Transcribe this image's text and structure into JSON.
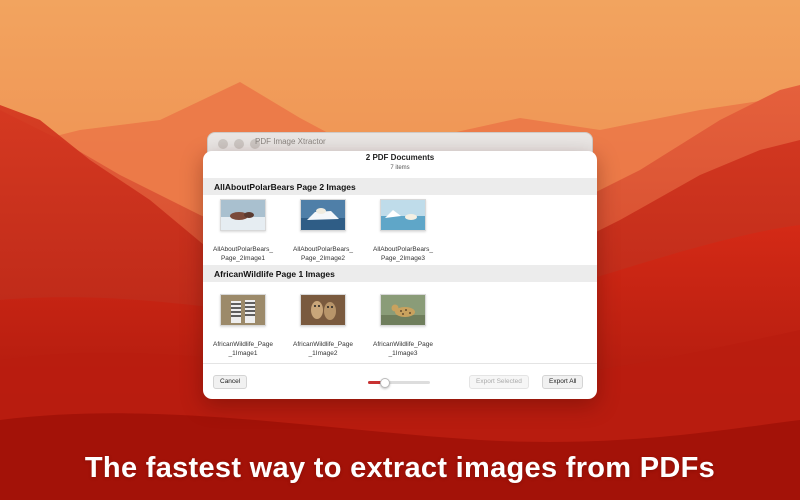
{
  "window": {
    "title": "PDF Image Xtractor"
  },
  "sheet": {
    "title": "2 PDF Documents",
    "subtitle": "7 items"
  },
  "sections": [
    {
      "header": "AllAboutPolarBears Page 2 Images",
      "items": [
        {
          "line1": "AllAboutPolarBears_",
          "line2": "Page_2Image1",
          "thumb": "polar-bears-on-ice-icon"
        },
        {
          "line1": "AllAboutPolarBears_",
          "line2": "Page_2Image2",
          "thumb": "polar-bears-on-floe-icon"
        },
        {
          "line1": "AllAboutPolarBears_",
          "line2": "Page_2Image3",
          "thumb": "polar-bear-in-water-icon"
        }
      ]
    },
    {
      "header": "AfricanWildlife Page 1 Images",
      "items": [
        {
          "line1": "AfricanWildlife_Page",
          "line2": "_1Image1",
          "thumb": "zebras-icon"
        },
        {
          "line1": "AfricanWildlife_Page",
          "line2": "_1Image2",
          "thumb": "meerkats-icon"
        },
        {
          "line1": "AfricanWildlife_Page",
          "line2": "_1Image3",
          "thumb": "leopard-icon"
        }
      ]
    }
  ],
  "footer": {
    "cancel_label": "Cancel",
    "export_selected_label": "Export Selected",
    "export_all_label": "Export All",
    "zoom_level": 0.25
  },
  "tagline": "The fastest way to extract images from PDFs",
  "colors": {
    "accent": "#c83232",
    "background_orange": "#f2a25e",
    "hills_red": "#c82a1a"
  }
}
